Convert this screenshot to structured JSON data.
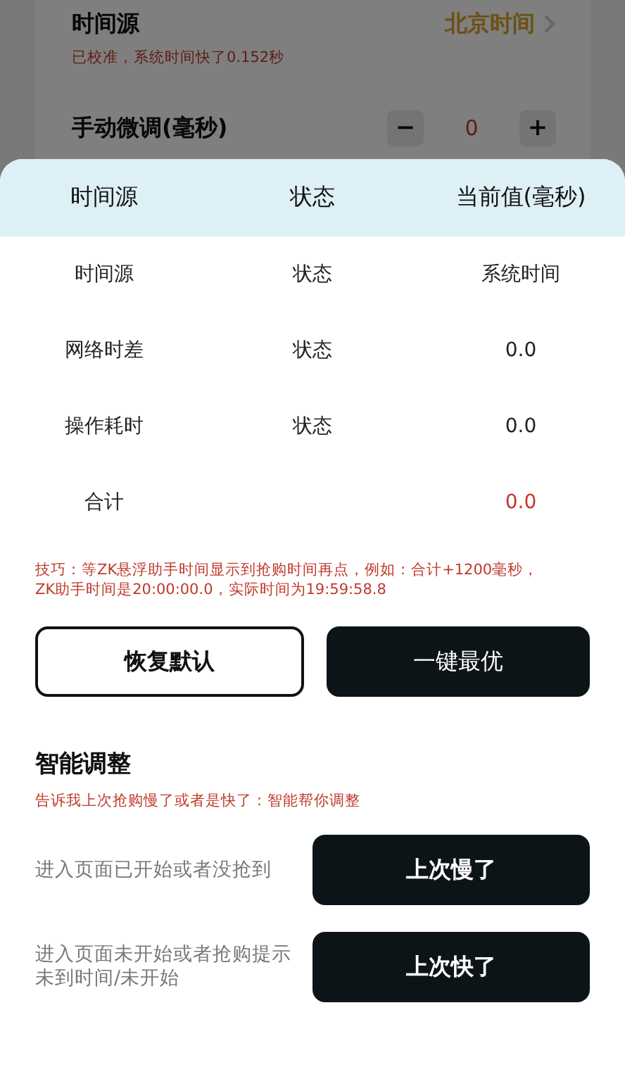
{
  "time_source": {
    "label": "时间源",
    "value": "北京时间",
    "status": "已校准，系统时间快了0.152秒"
  },
  "manual_adjust": {
    "label": "手动微调(毫秒)",
    "minus": "−",
    "value": "0",
    "plus": "+"
  },
  "table": {
    "columns": [
      "时间源",
      "状态",
      "当前值(毫秒)"
    ],
    "rows": [
      {
        "kind": "normal",
        "name": "时间源",
        "status": "状态",
        "value": "系统时间"
      },
      {
        "kind": "normal",
        "name": "网络时差",
        "status": "状态",
        "value": "0.0"
      },
      {
        "kind": "normal",
        "name": "操作耗时",
        "status": "状态",
        "value": "0.0"
      },
      {
        "kind": "total",
        "name": "合计",
        "value": "0.0"
      }
    ]
  },
  "tip": "技巧：等ZK悬浮助手时间显示到抢购时间再点，例如：合计+1200毫秒，ZK助手时间是20:00:00.0，实际时间为19:59:58.8",
  "buttons": [
    {
      "kind": "outline",
      "label": "恢复默认"
    },
    {
      "kind": "filled",
      "label": "一键最优"
    }
  ],
  "smart": {
    "title": "智能调整",
    "subtitle": "告诉我上次抢购慢了或者是快了：智能帮你调整",
    "items": [
      {
        "text": "进入页面已开始或者没抢到",
        "button": "上次慢了"
      },
      {
        "text": "进入页面未开始或者抢购提示未到时间/未开始",
        "button": "上次快了"
      }
    ]
  }
}
